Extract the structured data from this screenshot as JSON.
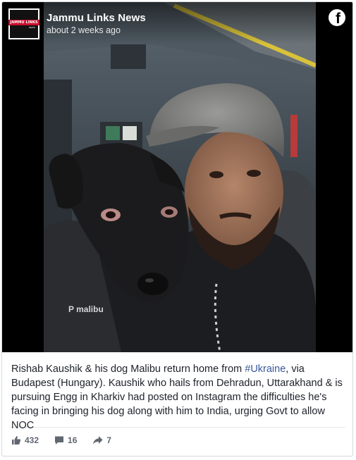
{
  "post": {
    "page_name": "Jammu Links News",
    "time": "about 2 weeks ago",
    "avatar_text": "JAMMU LINKS",
    "avatar_subtext": "NEWS",
    "brand_icon": "facebook-icon",
    "caption_before": "Rishab Kaushik & his dog Malibu return home from ",
    "hashtag": "#Ukraine",
    "caption_after": ", via Budapest (Hungary). Kaushik who hails from Dehradun, Uttarakhand & is pursuing Engg in Kharkiv had posted on Instagram the difficulties he's facing in bringing his dog along with him to India, urging Govt to allow NOC",
    "photo_jacket_text": "P malibu"
  },
  "engagement": {
    "likes": "432",
    "comments": "16",
    "shares": "7"
  },
  "colors": {
    "hashtag": "#385898",
    "text": "#1d2129",
    "muted": "#606770",
    "avatar_red": "#c8102e"
  }
}
